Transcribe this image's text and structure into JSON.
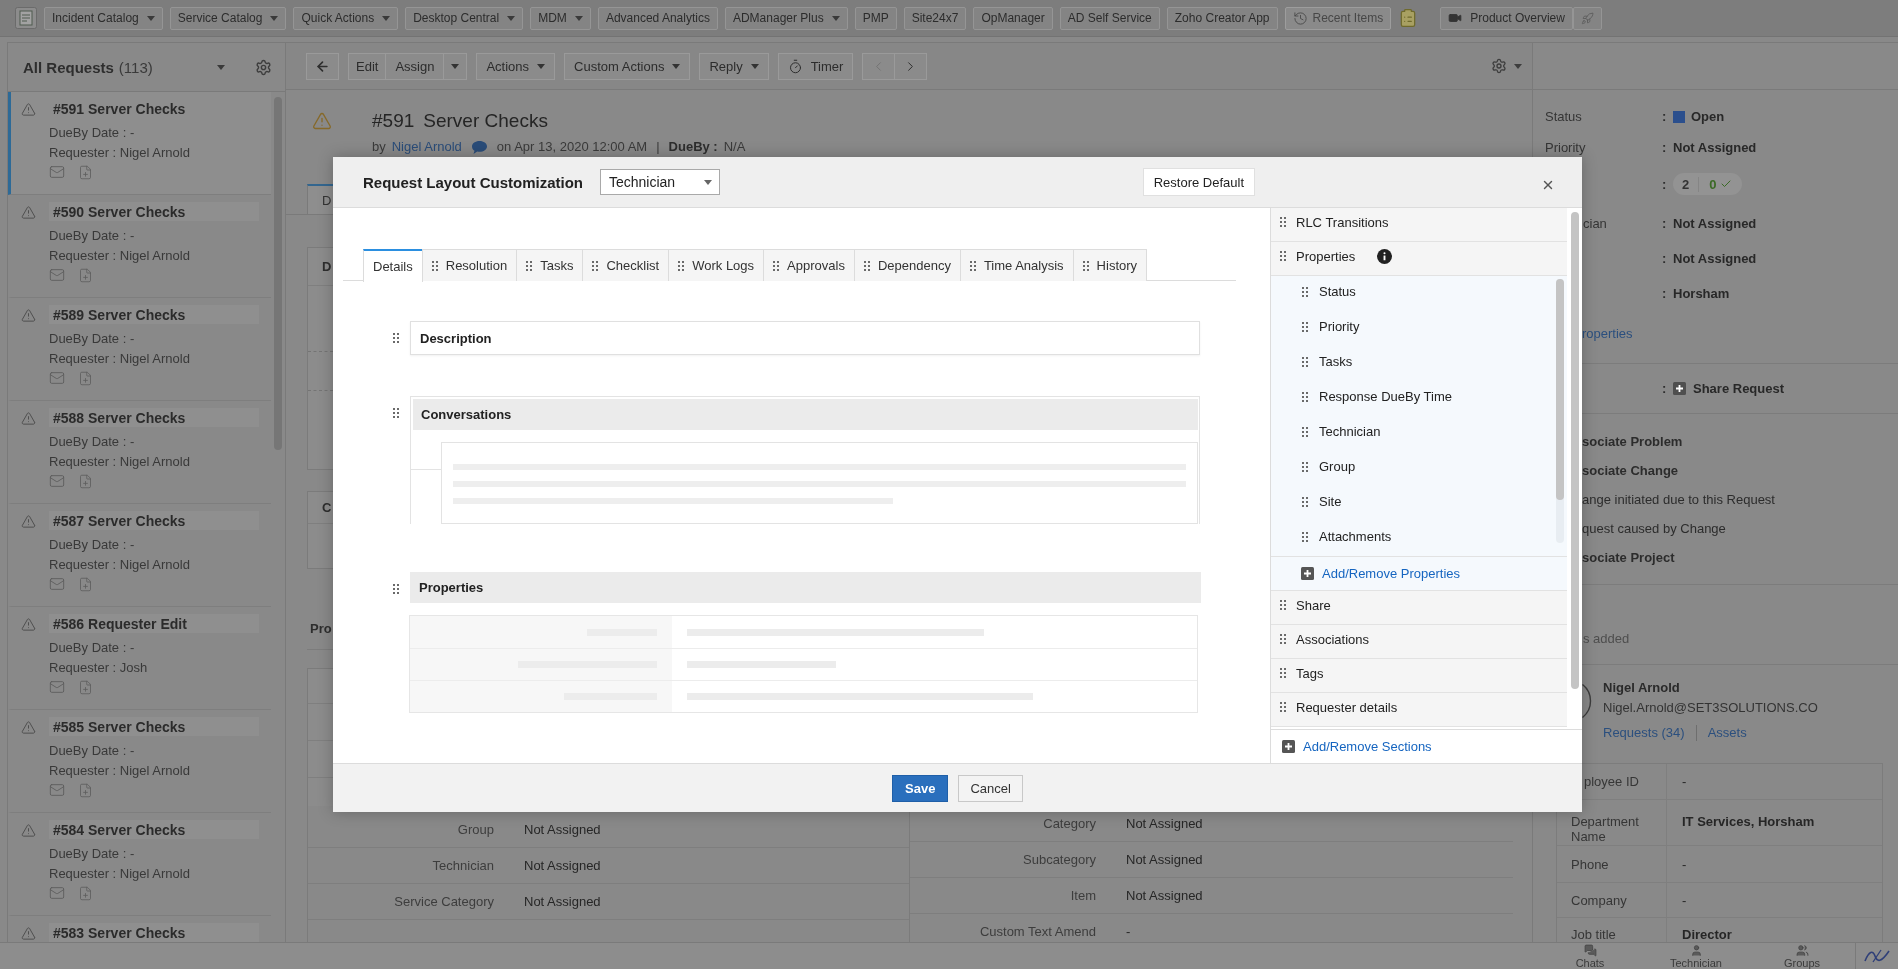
{
  "top_nav": {
    "items": [
      {
        "label": "Incident Catalog",
        "kind": "dropdown"
      },
      {
        "label": "Service Catalog",
        "kind": "dropdown"
      },
      {
        "label": "Quick Actions",
        "kind": "dropdown"
      },
      {
        "label": "Desktop Central",
        "kind": "dropdown"
      },
      {
        "label": "MDM",
        "kind": "dropdown"
      },
      {
        "label": "Advanced Analytics",
        "kind": "plain"
      },
      {
        "label": "ADManager Plus",
        "kind": "dropdown"
      },
      {
        "label": "PMP",
        "kind": "plain"
      },
      {
        "label": "Site24x7",
        "kind": "plain"
      },
      {
        "label": "OpManager",
        "kind": "plain"
      },
      {
        "label": "AD Self Service",
        "kind": "plain"
      },
      {
        "label": "Zoho Creator App",
        "kind": "plain"
      },
      {
        "label": "Recent Items",
        "kind": "recent"
      }
    ],
    "product_overview": "Product Overview"
  },
  "request_list": {
    "title": "All Requests",
    "count": "(113)",
    "items": [
      {
        "title": "#591 Server Checks",
        "due": "DueBy Date : -",
        "requester": "Requester : Nigel Arnold",
        "selected": true
      },
      {
        "title": "#590 Server Checks",
        "due": "DueBy Date : -",
        "requester": "Requester : Nigel Arnold",
        "selected": false
      },
      {
        "title": "#589 Server Checks",
        "due": "DueBy Date : -",
        "requester": "Requester : Nigel Arnold",
        "selected": false
      },
      {
        "title": "#588 Server Checks",
        "due": "DueBy Date : -",
        "requester": "Requester : Nigel Arnold",
        "selected": false
      },
      {
        "title": "#587 Server Checks",
        "due": "DueBy Date : -",
        "requester": "Requester : Nigel Arnold",
        "selected": false
      },
      {
        "title": "#586 Requester Edit",
        "due": "DueBy Date : -",
        "requester": "Requester : Josh",
        "selected": false
      },
      {
        "title": "#585 Server Checks",
        "due": "DueBy Date : -",
        "requester": "Requester : Nigel Arnold",
        "selected": false
      },
      {
        "title": "#584 Server Checks",
        "due": "DueBy Date : -",
        "requester": "Requester : Nigel Arnold",
        "selected": false
      },
      {
        "title": "#583 Server Checks",
        "selected": false
      }
    ]
  },
  "toolbar": {
    "groups": [
      {
        "buttons": [
          {
            "label": "Edit",
            "kind": "plain"
          },
          {
            "label": "Assign",
            "kind": "split"
          }
        ]
      },
      {
        "buttons": [
          {
            "label": "Actions",
            "kind": "dropdown"
          }
        ]
      },
      {
        "buttons": [
          {
            "label": "Custom Actions",
            "kind": "dropdown"
          }
        ]
      },
      {
        "buttons": [
          {
            "label": "Reply",
            "kind": "dropdown"
          }
        ]
      },
      {
        "buttons": [
          {
            "label": "Timer",
            "kind": "timer"
          }
        ]
      }
    ],
    "pager": [
      {
        "kind": "prev",
        "disabled": true
      },
      {
        "kind": "next",
        "disabled": false
      }
    ]
  },
  "request": {
    "number": "#591",
    "subject": "Server Checks",
    "by": "by",
    "author": "Nigel Arnold",
    "date": "on Apr 13, 2020 12:00 AM",
    "separator": "|",
    "due_label": "DueBy :",
    "due": "N/A"
  },
  "details_strip": {
    "tab": {
      "label": "D",
      "selected": true
    },
    "section_titles": [
      "D",
      "C"
    ],
    "heading": "Pro"
  },
  "properties_table": {
    "left": [
      {
        "label": "Group",
        "value": "Not Assigned"
      },
      {
        "label": "Technician",
        "value": "Not Assigned"
      },
      {
        "label": "Service Category",
        "value": "Not Assigned"
      }
    ],
    "right": [
      {
        "label": "Category",
        "value": "Not Assigned"
      },
      {
        "label": "Subcategory",
        "value": "Not Assigned"
      },
      {
        "label": "Item",
        "value": "Not Assigned"
      },
      {
        "label": "Custom Text Amend",
        "value": "-"
      }
    ]
  },
  "details_panel": {
    "fields": [
      {
        "kind": "status",
        "label": "Status",
        "colon": ":",
        "value": "Open"
      },
      {
        "kind": "text",
        "label": "Priority",
        "colon": ":",
        "value": "Not Assigned"
      },
      {
        "kind": "counts",
        "colon": ":",
        "counts": [
          {
            "value": "2",
            "done": false
          },
          {
            "value": "0",
            "done": true
          }
        ]
      },
      {
        "kind": "text",
        "label": "cian",
        "colon": ":",
        "value": "Not Assigned"
      },
      {
        "kind": "text",
        "colon": ":",
        "value": "Not Assigned"
      },
      {
        "kind": "text",
        "colon": ":",
        "value": "Horsham"
      }
    ],
    "properties_link": "roperties",
    "share": {
      "colon": ":",
      "label": "Share Request"
    },
    "associations": [
      {
        "kind": "action",
        "text": "sociate Problem"
      },
      {
        "kind": "action",
        "text": "sociate Change"
      },
      {
        "kind": "note",
        "text": "ange initiated due to this Request"
      },
      {
        "kind": "note",
        "text": "quest caused by Change"
      },
      {
        "kind": "action",
        "text": "sociate Project"
      }
    ],
    "tags_note": "s added",
    "requester": {
      "name": "Nigel Arnold",
      "email": "Nigel.Arnold@SET3SOLUTIONS.CO",
      "links": [
        "Requests (34)",
        "Assets"
      ]
    },
    "info": [
      {
        "label": "ployee ID",
        "value": "-"
      },
      {
        "label": "Department Name",
        "value": "IT Services, Horsham"
      },
      {
        "label": "Phone",
        "value": "-"
      },
      {
        "label": "Company",
        "value": "-"
      },
      {
        "label": "Job title",
        "value": "Director"
      }
    ]
  },
  "bottom_bar": {
    "items": [
      {
        "label": "Chats",
        "kind": "chats"
      },
      {
        "label": "Technician",
        "kind": "technician"
      },
      {
        "label": "Groups",
        "kind": "groups"
      }
    ]
  },
  "layout_dialog": {
    "title": "Request Layout Customization",
    "role": "Technician",
    "restore": "Restore Default",
    "tabs": [
      {
        "label": "Details",
        "selected": true,
        "draggable": false
      },
      {
        "label": "Resolution",
        "selected": false,
        "draggable": true
      },
      {
        "label": "Tasks",
        "selected": false,
        "draggable": true
      },
      {
        "label": "Checklist",
        "selected": false,
        "draggable": true
      },
      {
        "label": "Work Logs",
        "selected": false,
        "draggable": true
      },
      {
        "label": "Approvals",
        "selected": false,
        "draggable": true
      },
      {
        "label": "Dependency",
        "selected": false,
        "draggable": true
      },
      {
        "label": "Time Analysis",
        "selected": false,
        "draggable": true
      },
      {
        "label": "History",
        "selected": false,
        "draggable": true
      }
    ],
    "sections": [
      {
        "title": "Description",
        "kind": "plain"
      },
      {
        "title": "Conversations",
        "kind": "conversations"
      },
      {
        "title": "Properties",
        "kind": "properties"
      }
    ],
    "side_sections": [
      {
        "label": "RLC Transitions",
        "info": false
      },
      {
        "label": "Properties",
        "info": true,
        "children": [
          {
            "label": "Status"
          },
          {
            "label": "Priority"
          },
          {
            "label": "Tasks"
          },
          {
            "label": "Response DueBy Time"
          },
          {
            "label": "Technician"
          },
          {
            "label": "Group"
          },
          {
            "label": "Site"
          },
          {
            "label": "Attachments"
          }
        ],
        "add_link": "Add/Remove Properties"
      },
      {
        "label": "Share",
        "info": false
      },
      {
        "label": "Associations",
        "info": false
      },
      {
        "label": "Tags",
        "info": false
      },
      {
        "label": "Requester details",
        "info": false
      }
    ],
    "add_sections": "Add/Remove Sections",
    "buttons": [
      {
        "label": "Save",
        "kind": "primary"
      },
      {
        "label": "Cancel",
        "kind": "secondary"
      }
    ]
  }
}
